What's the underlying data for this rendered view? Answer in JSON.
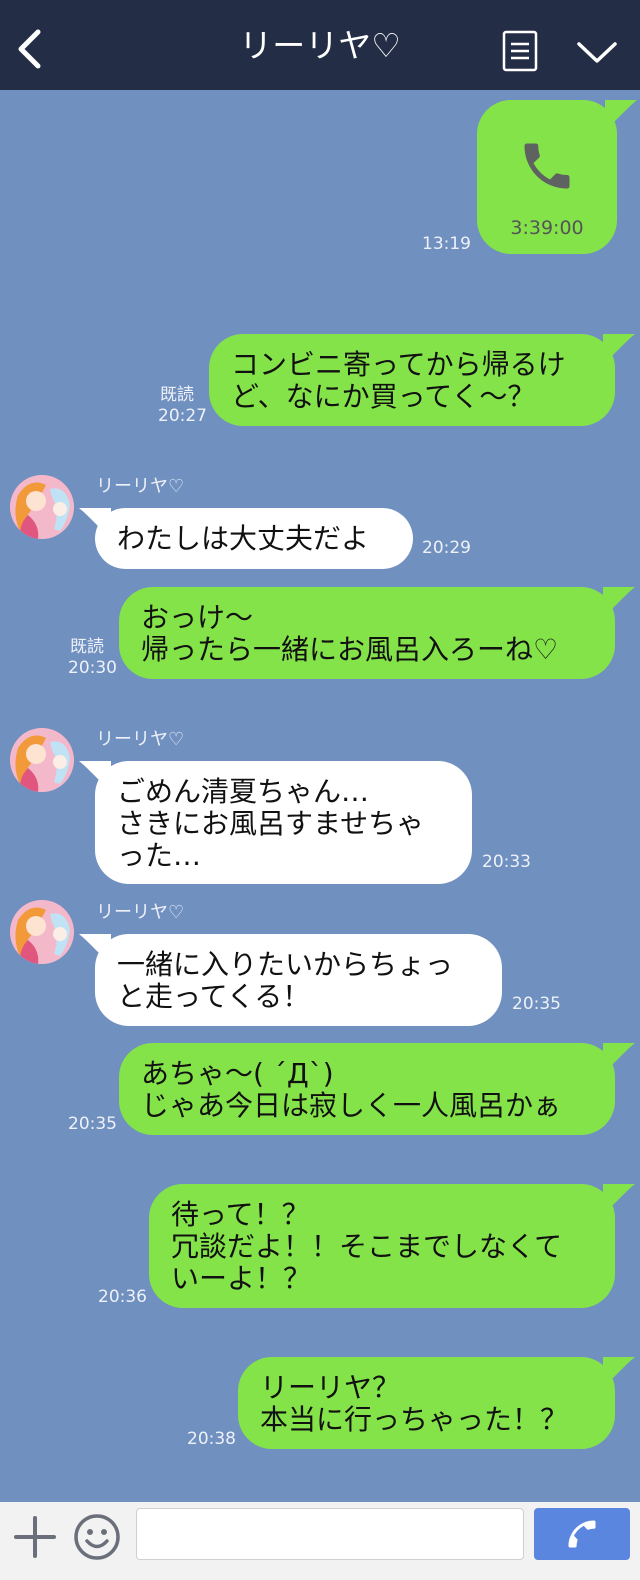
{
  "header": {
    "title": "リーリヤ♡",
    "back_icon": "chevron-left-icon",
    "menu_icon": "notes-icon",
    "collapse_icon": "chevron-down-icon"
  },
  "colors": {
    "header_bg": "#232d45",
    "chat_bg": "#7090c0",
    "outgoing_bubble": "#85e34a",
    "incoming_bubble": "#ffffff",
    "send_button": "#5b86df"
  },
  "messages": [
    {
      "direction": "out",
      "type": "call",
      "icon": "phone-icon",
      "duration": "3:39:00",
      "time": "13:19"
    },
    {
      "direction": "out",
      "text": "コンビニ寄ってから帰るけ\nど、なにか買ってく〜？",
      "read": "既読",
      "time": "20:27"
    },
    {
      "direction": "in",
      "sender": "リーリヤ♡",
      "text": "わたしは大丈夫だよ",
      "time": "20:29"
    },
    {
      "direction": "out",
      "text": "おっけ〜\n帰ったら一緒にお風呂入ろーね♡",
      "read": "既読",
      "time": "20:30"
    },
    {
      "direction": "in",
      "sender": "リーリヤ♡",
      "text": "ごめん清夏ちゃん…\nさきにお風呂すませちゃ\nった…",
      "time": "20:33"
    },
    {
      "direction": "in",
      "sender": "リーリヤ♡",
      "text": "一緒に入りたいからちょっ\nと走ってくる！",
      "time": "20:35"
    },
    {
      "direction": "out",
      "text": "あちゃ〜( ´Д`)\nじゃあ今日は寂しく一人風呂かぁ",
      "time": "20:35"
    },
    {
      "direction": "out",
      "text": "待って！？\n冗談だよ！！そこまでしなくて\nいーよ！？",
      "time": "20:36"
    },
    {
      "direction": "out",
      "text": "リーリヤ？\n本当に行っちゃった！？",
      "time": "20:38"
    }
  ],
  "input": {
    "placeholder": "",
    "value": "",
    "plus_icon": "plus-icon",
    "emoji_icon": "smiley-icon",
    "send_icon": "phone-icon"
  }
}
